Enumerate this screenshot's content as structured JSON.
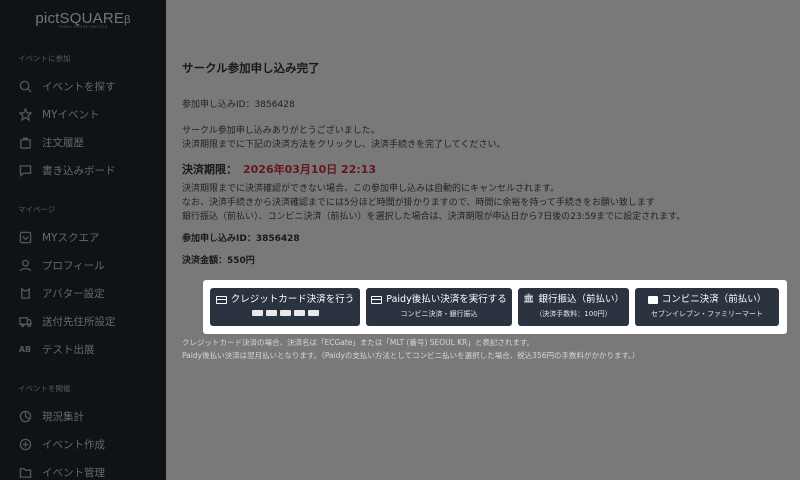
{
  "sidebar": {
    "logo": "pictSQUARE",
    "logo_beta": "β",
    "logo_sub": "make event service",
    "sections": [
      {
        "title": "イベントに参加",
        "items": [
          {
            "label": "イベントを探す",
            "icon": "search-icon"
          },
          {
            "label": "MYイベント",
            "icon": "star-icon"
          },
          {
            "label": "注文履歴",
            "icon": "bag-icon"
          },
          {
            "label": "書き込みボード",
            "icon": "chat-icon"
          }
        ]
      },
      {
        "title": "マイページ",
        "items": [
          {
            "label": "MYスクエア",
            "icon": "square-icon"
          },
          {
            "label": "プロフィール",
            "icon": "user-icon"
          },
          {
            "label": "アバター設定",
            "icon": "avatar-icon"
          },
          {
            "label": "送付先住所設定",
            "icon": "truck-icon"
          },
          {
            "label": "テスト出展",
            "icon": "ab-icon"
          }
        ]
      },
      {
        "title": "イベントを開催",
        "items": [
          {
            "label": "現況集計",
            "icon": "stats-icon"
          },
          {
            "label": "イベント作成",
            "icon": "plus-circle-icon"
          },
          {
            "label": "イベント管理",
            "icon": "folder-icon"
          }
        ]
      }
    ]
  },
  "main": {
    "title": "サークル参加申し込み完了",
    "application_id_line": "参加申し込みID：3856428",
    "thanks_line1": "サークル参加申し込みありがとうございました。",
    "thanks_line2": "決済期限までに下記の決済方法をクリックし、決済手続きを完了してください。",
    "deadline_label": "決済期限：",
    "deadline_value": "2026年03月10日 22:13",
    "notice_line1": "決済期限までに決済確認ができない場合、この参加申し込みは自動的にキャンセルされます。",
    "notice_line2": "なお、決済手続きから決済確認までには5分ほど時間が掛かりますので、時間に余裕を持って手続きをお願い致します",
    "notice_line3": "銀行振込（前払い）、コンビニ決済（前払い）を選択した場合は、決済期限が申込日から7日後の23:59までに設定されます。",
    "application_id_bold": "参加申し込みID：3856428",
    "amount_line": "決済金額：550円"
  },
  "payment": {
    "credit": {
      "label": "クレジットカード決済を行う",
      "icon": "credit-card-icon"
    },
    "paidy": {
      "label": "Paidy後払い決済を実行する",
      "sub": "コンビニ決済・銀行振込",
      "icon": "paidy-card-icon"
    },
    "bank": {
      "label": "銀行振込（前払い）",
      "sub": "（決済手数料：100円）",
      "icon": "bank-icon"
    },
    "conv": {
      "label": "コンビニ決済（前払い）",
      "sub": "セブンイレブン・ファミリーマート",
      "icon": "store-icon"
    }
  },
  "notes": {
    "line1": "クレジットカード決済の場合、決済名は「ECGate」または「MLT (番号) SEOUL KR」と表記されます。",
    "line2": "Paidy後払い決済は翌月払いとなります。（Paidyの支払い方法としてコンビニ払いを選択した場合、税込356円の手数料がかかります。）"
  }
}
